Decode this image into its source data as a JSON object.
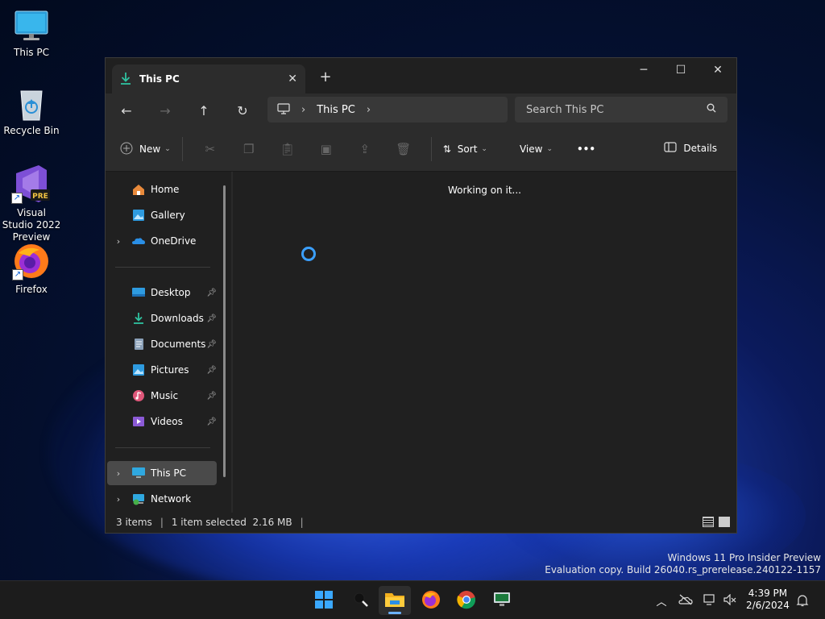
{
  "desktop": {
    "icons": [
      {
        "label": "This PC"
      },
      {
        "label": "Recycle Bin"
      },
      {
        "label": "Visual Studio 2022 Preview",
        "badge": "PRE"
      },
      {
        "label": "Firefox"
      }
    ]
  },
  "window": {
    "tab_title": "This PC",
    "nav": {
      "breadcrumb": "This PC",
      "search_placeholder": "Search This PC"
    },
    "toolbar": {
      "new_label": "New",
      "sort_label": "Sort",
      "view_label": "View",
      "more_label": "•••",
      "details_label": "Details"
    },
    "sidebar": {
      "top": [
        {
          "label": "Home"
        },
        {
          "label": "Gallery"
        },
        {
          "label": "OneDrive"
        }
      ],
      "pinned": [
        {
          "label": "Desktop"
        },
        {
          "label": "Downloads"
        },
        {
          "label": "Documents"
        },
        {
          "label": "Pictures"
        },
        {
          "label": "Music"
        },
        {
          "label": "Videos"
        }
      ],
      "bottom": [
        {
          "label": "This PC"
        },
        {
          "label": "Network"
        }
      ]
    },
    "content": {
      "status_text": "Working on it..."
    },
    "statusbar": {
      "item_count": "3 items",
      "selection": "1 item selected  2.16 MB"
    }
  },
  "watermark": {
    "line1": "Windows 11 Pro Insider Preview",
    "line2": "Evaluation copy. Build 26040.rs_prerelease.240122-1157"
  },
  "taskbar": {
    "time": "4:39 PM",
    "date": "2/6/2024"
  },
  "colors": {
    "accent": "#3ba0ff",
    "window_bg": "#202020",
    "toolbar_bg": "#2c2c2c"
  }
}
